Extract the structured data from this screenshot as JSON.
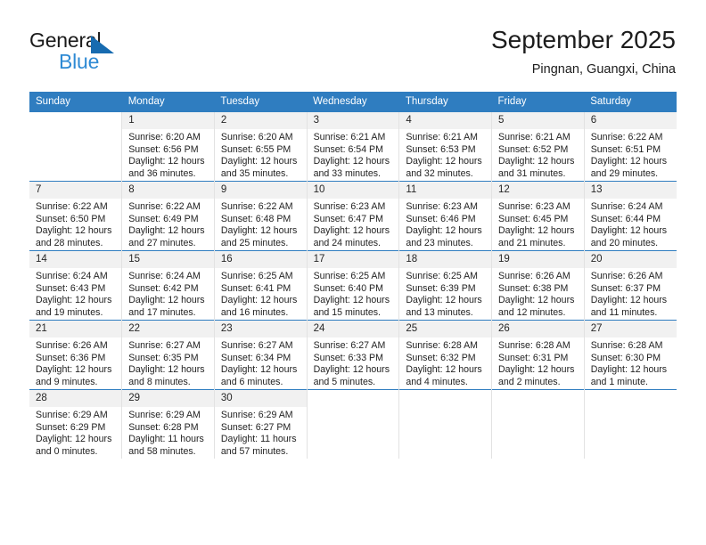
{
  "brand": {
    "name_part1": "General",
    "name_part2": "Blue",
    "triangle_color": "#176bb0",
    "blue_color": "#2e8ad4"
  },
  "header": {
    "title": "September 2025",
    "subtitle": "Pingnan, Guangxi, China"
  },
  "theme": {
    "header_bg": "#2f7dc0",
    "daynum_bg": "#f1f1f1",
    "grid_line": "#e2e2e2",
    "text": "#222222"
  },
  "weekday_headers": [
    "Sunday",
    "Monday",
    "Tuesday",
    "Wednesday",
    "Thursday",
    "Friday",
    "Saturday"
  ],
  "weeks": [
    [
      {
        "day": "",
        "sunrise": "",
        "sunset": "",
        "daylight1": "",
        "daylight2": ""
      },
      {
        "day": "1",
        "sunrise": "Sunrise: 6:20 AM",
        "sunset": "Sunset: 6:56 PM",
        "daylight1": "Daylight: 12 hours",
        "daylight2": "and 36 minutes."
      },
      {
        "day": "2",
        "sunrise": "Sunrise: 6:20 AM",
        "sunset": "Sunset: 6:55 PM",
        "daylight1": "Daylight: 12 hours",
        "daylight2": "and 35 minutes."
      },
      {
        "day": "3",
        "sunrise": "Sunrise: 6:21 AM",
        "sunset": "Sunset: 6:54 PM",
        "daylight1": "Daylight: 12 hours",
        "daylight2": "and 33 minutes."
      },
      {
        "day": "4",
        "sunrise": "Sunrise: 6:21 AM",
        "sunset": "Sunset: 6:53 PM",
        "daylight1": "Daylight: 12 hours",
        "daylight2": "and 32 minutes."
      },
      {
        "day": "5",
        "sunrise": "Sunrise: 6:21 AM",
        "sunset": "Sunset: 6:52 PM",
        "daylight1": "Daylight: 12 hours",
        "daylight2": "and 31 minutes."
      },
      {
        "day": "6",
        "sunrise": "Sunrise: 6:22 AM",
        "sunset": "Sunset: 6:51 PM",
        "daylight1": "Daylight: 12 hours",
        "daylight2": "and 29 minutes."
      }
    ],
    [
      {
        "day": "7",
        "sunrise": "Sunrise: 6:22 AM",
        "sunset": "Sunset: 6:50 PM",
        "daylight1": "Daylight: 12 hours",
        "daylight2": "and 28 minutes."
      },
      {
        "day": "8",
        "sunrise": "Sunrise: 6:22 AM",
        "sunset": "Sunset: 6:49 PM",
        "daylight1": "Daylight: 12 hours",
        "daylight2": "and 27 minutes."
      },
      {
        "day": "9",
        "sunrise": "Sunrise: 6:22 AM",
        "sunset": "Sunset: 6:48 PM",
        "daylight1": "Daylight: 12 hours",
        "daylight2": "and 25 minutes."
      },
      {
        "day": "10",
        "sunrise": "Sunrise: 6:23 AM",
        "sunset": "Sunset: 6:47 PM",
        "daylight1": "Daylight: 12 hours",
        "daylight2": "and 24 minutes."
      },
      {
        "day": "11",
        "sunrise": "Sunrise: 6:23 AM",
        "sunset": "Sunset: 6:46 PM",
        "daylight1": "Daylight: 12 hours",
        "daylight2": "and 23 minutes."
      },
      {
        "day": "12",
        "sunrise": "Sunrise: 6:23 AM",
        "sunset": "Sunset: 6:45 PM",
        "daylight1": "Daylight: 12 hours",
        "daylight2": "and 21 minutes."
      },
      {
        "day": "13",
        "sunrise": "Sunrise: 6:24 AM",
        "sunset": "Sunset: 6:44 PM",
        "daylight1": "Daylight: 12 hours",
        "daylight2": "and 20 minutes."
      }
    ],
    [
      {
        "day": "14",
        "sunrise": "Sunrise: 6:24 AM",
        "sunset": "Sunset: 6:43 PM",
        "daylight1": "Daylight: 12 hours",
        "daylight2": "and 19 minutes."
      },
      {
        "day": "15",
        "sunrise": "Sunrise: 6:24 AM",
        "sunset": "Sunset: 6:42 PM",
        "daylight1": "Daylight: 12 hours",
        "daylight2": "and 17 minutes."
      },
      {
        "day": "16",
        "sunrise": "Sunrise: 6:25 AM",
        "sunset": "Sunset: 6:41 PM",
        "daylight1": "Daylight: 12 hours",
        "daylight2": "and 16 minutes."
      },
      {
        "day": "17",
        "sunrise": "Sunrise: 6:25 AM",
        "sunset": "Sunset: 6:40 PM",
        "daylight1": "Daylight: 12 hours",
        "daylight2": "and 15 minutes."
      },
      {
        "day": "18",
        "sunrise": "Sunrise: 6:25 AM",
        "sunset": "Sunset: 6:39 PM",
        "daylight1": "Daylight: 12 hours",
        "daylight2": "and 13 minutes."
      },
      {
        "day": "19",
        "sunrise": "Sunrise: 6:26 AM",
        "sunset": "Sunset: 6:38 PM",
        "daylight1": "Daylight: 12 hours",
        "daylight2": "and 12 minutes."
      },
      {
        "day": "20",
        "sunrise": "Sunrise: 6:26 AM",
        "sunset": "Sunset: 6:37 PM",
        "daylight1": "Daylight: 12 hours",
        "daylight2": "and 11 minutes."
      }
    ],
    [
      {
        "day": "21",
        "sunrise": "Sunrise: 6:26 AM",
        "sunset": "Sunset: 6:36 PM",
        "daylight1": "Daylight: 12 hours",
        "daylight2": "and 9 minutes."
      },
      {
        "day": "22",
        "sunrise": "Sunrise: 6:27 AM",
        "sunset": "Sunset: 6:35 PM",
        "daylight1": "Daylight: 12 hours",
        "daylight2": "and 8 minutes."
      },
      {
        "day": "23",
        "sunrise": "Sunrise: 6:27 AM",
        "sunset": "Sunset: 6:34 PM",
        "daylight1": "Daylight: 12 hours",
        "daylight2": "and 6 minutes."
      },
      {
        "day": "24",
        "sunrise": "Sunrise: 6:27 AM",
        "sunset": "Sunset: 6:33 PM",
        "daylight1": "Daylight: 12 hours",
        "daylight2": "and 5 minutes."
      },
      {
        "day": "25",
        "sunrise": "Sunrise: 6:28 AM",
        "sunset": "Sunset: 6:32 PM",
        "daylight1": "Daylight: 12 hours",
        "daylight2": "and 4 minutes."
      },
      {
        "day": "26",
        "sunrise": "Sunrise: 6:28 AM",
        "sunset": "Sunset: 6:31 PM",
        "daylight1": "Daylight: 12 hours",
        "daylight2": "and 2 minutes."
      },
      {
        "day": "27",
        "sunrise": "Sunrise: 6:28 AM",
        "sunset": "Sunset: 6:30 PM",
        "daylight1": "Daylight: 12 hours",
        "daylight2": "and 1 minute."
      }
    ],
    [
      {
        "day": "28",
        "sunrise": "Sunrise: 6:29 AM",
        "sunset": "Sunset: 6:29 PM",
        "daylight1": "Daylight: 12 hours",
        "daylight2": "and 0 minutes."
      },
      {
        "day": "29",
        "sunrise": "Sunrise: 6:29 AM",
        "sunset": "Sunset: 6:28 PM",
        "daylight1": "Daylight: 11 hours",
        "daylight2": "and 58 minutes."
      },
      {
        "day": "30",
        "sunrise": "Sunrise: 6:29 AM",
        "sunset": "Sunset: 6:27 PM",
        "daylight1": "Daylight: 11 hours",
        "daylight2": "and 57 minutes."
      },
      {
        "day": "",
        "sunrise": "",
        "sunset": "",
        "daylight1": "",
        "daylight2": ""
      },
      {
        "day": "",
        "sunrise": "",
        "sunset": "",
        "daylight1": "",
        "daylight2": ""
      },
      {
        "day": "",
        "sunrise": "",
        "sunset": "",
        "daylight1": "",
        "daylight2": ""
      },
      {
        "day": "",
        "sunrise": "",
        "sunset": "",
        "daylight1": "",
        "daylight2": ""
      }
    ]
  ]
}
